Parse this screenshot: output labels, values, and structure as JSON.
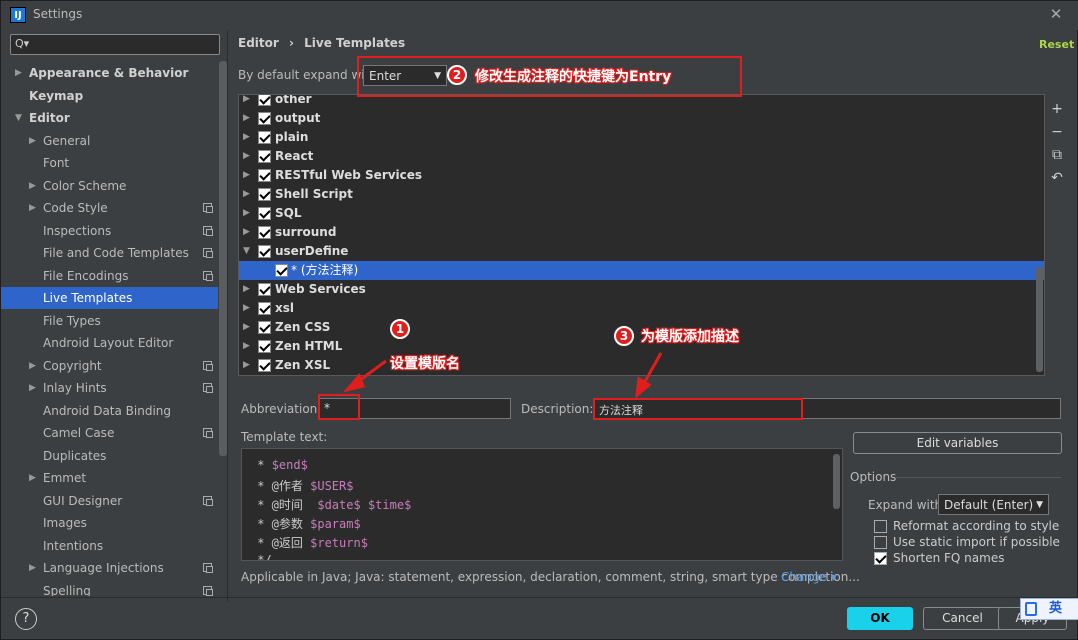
{
  "window": {
    "title": "Settings",
    "app_icon": "IJ",
    "close_glyph": "✕"
  },
  "search": {
    "value": "",
    "icon": "search-icon",
    "icon_glyph": "Q▾"
  },
  "sidebar": {
    "items": [
      {
        "label": "Appearance & Behavior",
        "bold": true,
        "arrow": "▶",
        "copy": false
      },
      {
        "label": "Keymap",
        "bold": true,
        "arrow": "",
        "copy": false
      },
      {
        "label": "Editor",
        "bold": true,
        "arrow": "▼",
        "copy": false
      },
      {
        "label": "General",
        "bold": false,
        "arrow": "▶",
        "copy": false
      },
      {
        "label": "Font",
        "bold": false,
        "arrow": "",
        "copy": false
      },
      {
        "label": "Color Scheme",
        "bold": false,
        "arrow": "▶",
        "copy": false
      },
      {
        "label": "Code Style",
        "bold": false,
        "arrow": "▶",
        "copy": true
      },
      {
        "label": "Inspections",
        "bold": false,
        "arrow": "",
        "copy": true
      },
      {
        "label": "File and Code Templates",
        "bold": false,
        "arrow": "",
        "copy": true
      },
      {
        "label": "File Encodings",
        "bold": false,
        "arrow": "",
        "copy": true
      },
      {
        "label": "Live Templates",
        "bold": false,
        "arrow": "",
        "copy": false,
        "selected": true
      },
      {
        "label": "File Types",
        "bold": false,
        "arrow": "",
        "copy": false
      },
      {
        "label": "Android Layout Editor",
        "bold": false,
        "arrow": "",
        "copy": false
      },
      {
        "label": "Copyright",
        "bold": false,
        "arrow": "▶",
        "copy": true
      },
      {
        "label": "Inlay Hints",
        "bold": false,
        "arrow": "▶",
        "copy": true
      },
      {
        "label": "Android Data Binding",
        "bold": false,
        "arrow": "",
        "copy": false
      },
      {
        "label": "Camel Case",
        "bold": false,
        "arrow": "",
        "copy": true
      },
      {
        "label": "Duplicates",
        "bold": false,
        "arrow": "",
        "copy": false
      },
      {
        "label": "Emmet",
        "bold": false,
        "arrow": "▶",
        "copy": false
      },
      {
        "label": "GUI Designer",
        "bold": false,
        "arrow": "",
        "copy": true
      },
      {
        "label": "Images",
        "bold": false,
        "arrow": "",
        "copy": false
      },
      {
        "label": "Intentions",
        "bold": false,
        "arrow": "",
        "copy": false
      },
      {
        "label": "Language Injections",
        "bold": false,
        "arrow": "▶",
        "copy": true
      },
      {
        "label": "Spelling",
        "bold": false,
        "arrow": "",
        "copy": true
      }
    ]
  },
  "header": {
    "breadcrumb_parent": "Editor",
    "breadcrumb_sep": "›",
    "breadcrumb_current": "Live Templates",
    "reset": "Reset"
  },
  "expand": {
    "label": "By default expand with",
    "value": "Enter",
    "caret": "▼"
  },
  "tree": {
    "rows": [
      {
        "label": "other",
        "expanded": false,
        "child": false
      },
      {
        "label": "output",
        "expanded": false,
        "child": false
      },
      {
        "label": "plain",
        "expanded": false,
        "child": false
      },
      {
        "label": "React",
        "expanded": false,
        "child": false
      },
      {
        "label": "RESTful Web Services",
        "expanded": false,
        "child": false
      },
      {
        "label": "Shell Script",
        "expanded": false,
        "child": false
      },
      {
        "label": "SQL",
        "expanded": false,
        "child": false
      },
      {
        "label": "surround",
        "expanded": false,
        "child": false
      },
      {
        "label": "userDefine",
        "expanded": true,
        "child": false
      },
      {
        "label": "* (方法注释)",
        "expanded": false,
        "child": true,
        "selected": true
      },
      {
        "label": "Web Services",
        "expanded": false,
        "child": false
      },
      {
        "label": "xsl",
        "expanded": false,
        "child": false
      },
      {
        "label": "Zen CSS",
        "expanded": false,
        "child": false
      },
      {
        "label": "Zen HTML",
        "expanded": false,
        "child": false
      },
      {
        "label": "Zen XSL",
        "expanded": false,
        "child": false
      }
    ],
    "tools": [
      {
        "name": "add-icon",
        "glyph": "+"
      },
      {
        "name": "remove-icon",
        "glyph": "−"
      },
      {
        "name": "copy-icon",
        "glyph": "⧉"
      },
      {
        "name": "restore-icon",
        "glyph": "↶"
      }
    ]
  },
  "abbreviation": {
    "label": "Abbreviation:",
    "value": "*"
  },
  "description": {
    "label": "Description:",
    "value": "方法注释"
  },
  "template_text": {
    "label": "Template text:",
    "lines": [
      {
        "prefix": " * ",
        "parts": [
          {
            "t": "$end$",
            "v": true
          }
        ]
      },
      {
        "prefix": " * @作者 ",
        "parts": [
          {
            "t": "$USER$",
            "v": true
          }
        ]
      },
      {
        "prefix": " * @时间  ",
        "parts": [
          {
            "t": "$date$",
            "v": true
          },
          {
            "t": " ",
            "v": false
          },
          {
            "t": "$time$",
            "v": true
          }
        ]
      },
      {
        "prefix": " * @参数 ",
        "parts": [
          {
            "t": "$param$",
            "v": true
          }
        ]
      },
      {
        "prefix": " * @返回 ",
        "parts": [
          {
            "t": "$return$",
            "v": true
          }
        ]
      },
      {
        "prefix": " */",
        "parts": []
      }
    ]
  },
  "applicable": {
    "text": "Applicable in Java; Java: statement, expression, declaration, comment, string, smart type completion...",
    "change": "Change ▾"
  },
  "options": {
    "edit_variables": "Edit variables",
    "title": "Options",
    "expand_with_label": "Expand with",
    "expand_with_value": "Default (Enter)",
    "caret": "▼",
    "checkboxes": [
      {
        "label": "Reformat according to style",
        "checked": false
      },
      {
        "label": "Use static import if possible",
        "checked": false
      },
      {
        "label": "Shorten FQ names",
        "checked": true
      }
    ]
  },
  "footer": {
    "help": "?",
    "ok": "OK",
    "cancel": "Cancel",
    "apply": "Apply"
  },
  "ime": {
    "text": "英"
  },
  "annotations": {
    "a1": {
      "num": "1",
      "text": "设置模版名"
    },
    "a2": {
      "num": "2",
      "text": "修改生成注释的快捷键为Entry"
    },
    "a3": {
      "num": "3",
      "text": "为模版添加描述"
    }
  },
  "colors": {
    "accent": "#2f65ca",
    "ok": "#19d1e9",
    "annotation": "#e01e1e",
    "reset": "#aed64b",
    "variable": "#c77dbb"
  }
}
